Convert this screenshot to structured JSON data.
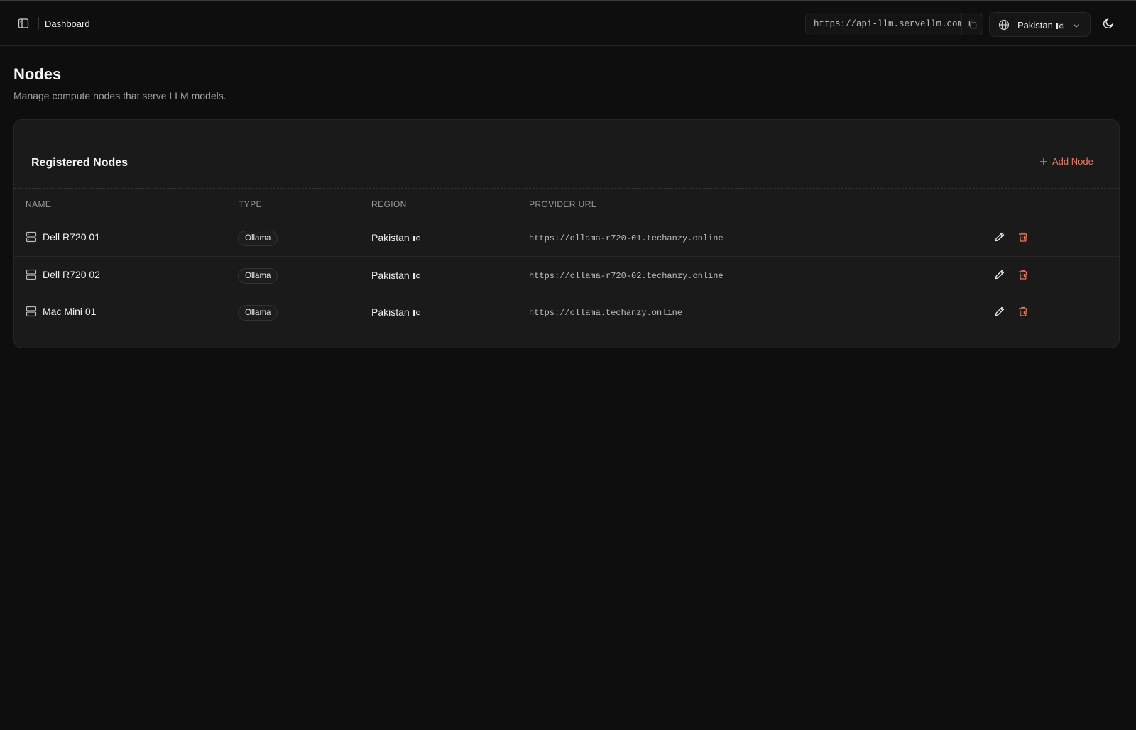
{
  "header": {
    "breadcrumb": "Dashboard",
    "api_url": "https://api-llm.servellm.com",
    "region_selector": "Pakistan"
  },
  "page": {
    "title": "Nodes",
    "subtitle": "Manage compute nodes that serve LLM models."
  },
  "card": {
    "title": "Registered Nodes",
    "add_button": "Add Node"
  },
  "table": {
    "columns": [
      "NAME",
      "TYPE",
      "REGION",
      "PROVIDER URL"
    ],
    "rows": [
      {
        "name": "Dell R720 01",
        "type": "Ollama",
        "region": "Pakistan",
        "url": "https://ollama-r720-01.techanzy.online"
      },
      {
        "name": "Dell R720 02",
        "type": "Ollama",
        "region": "Pakistan",
        "url": "https://ollama-r720-02.techanzy.online"
      },
      {
        "name": "Mac Mini 01",
        "type": "Ollama",
        "region": "Pakistan",
        "url": "https://ollama.techanzy.online"
      }
    ]
  },
  "colors": {
    "background": "#0e0e0e",
    "card": "#1a1a1a",
    "accent": "#e57a62"
  }
}
